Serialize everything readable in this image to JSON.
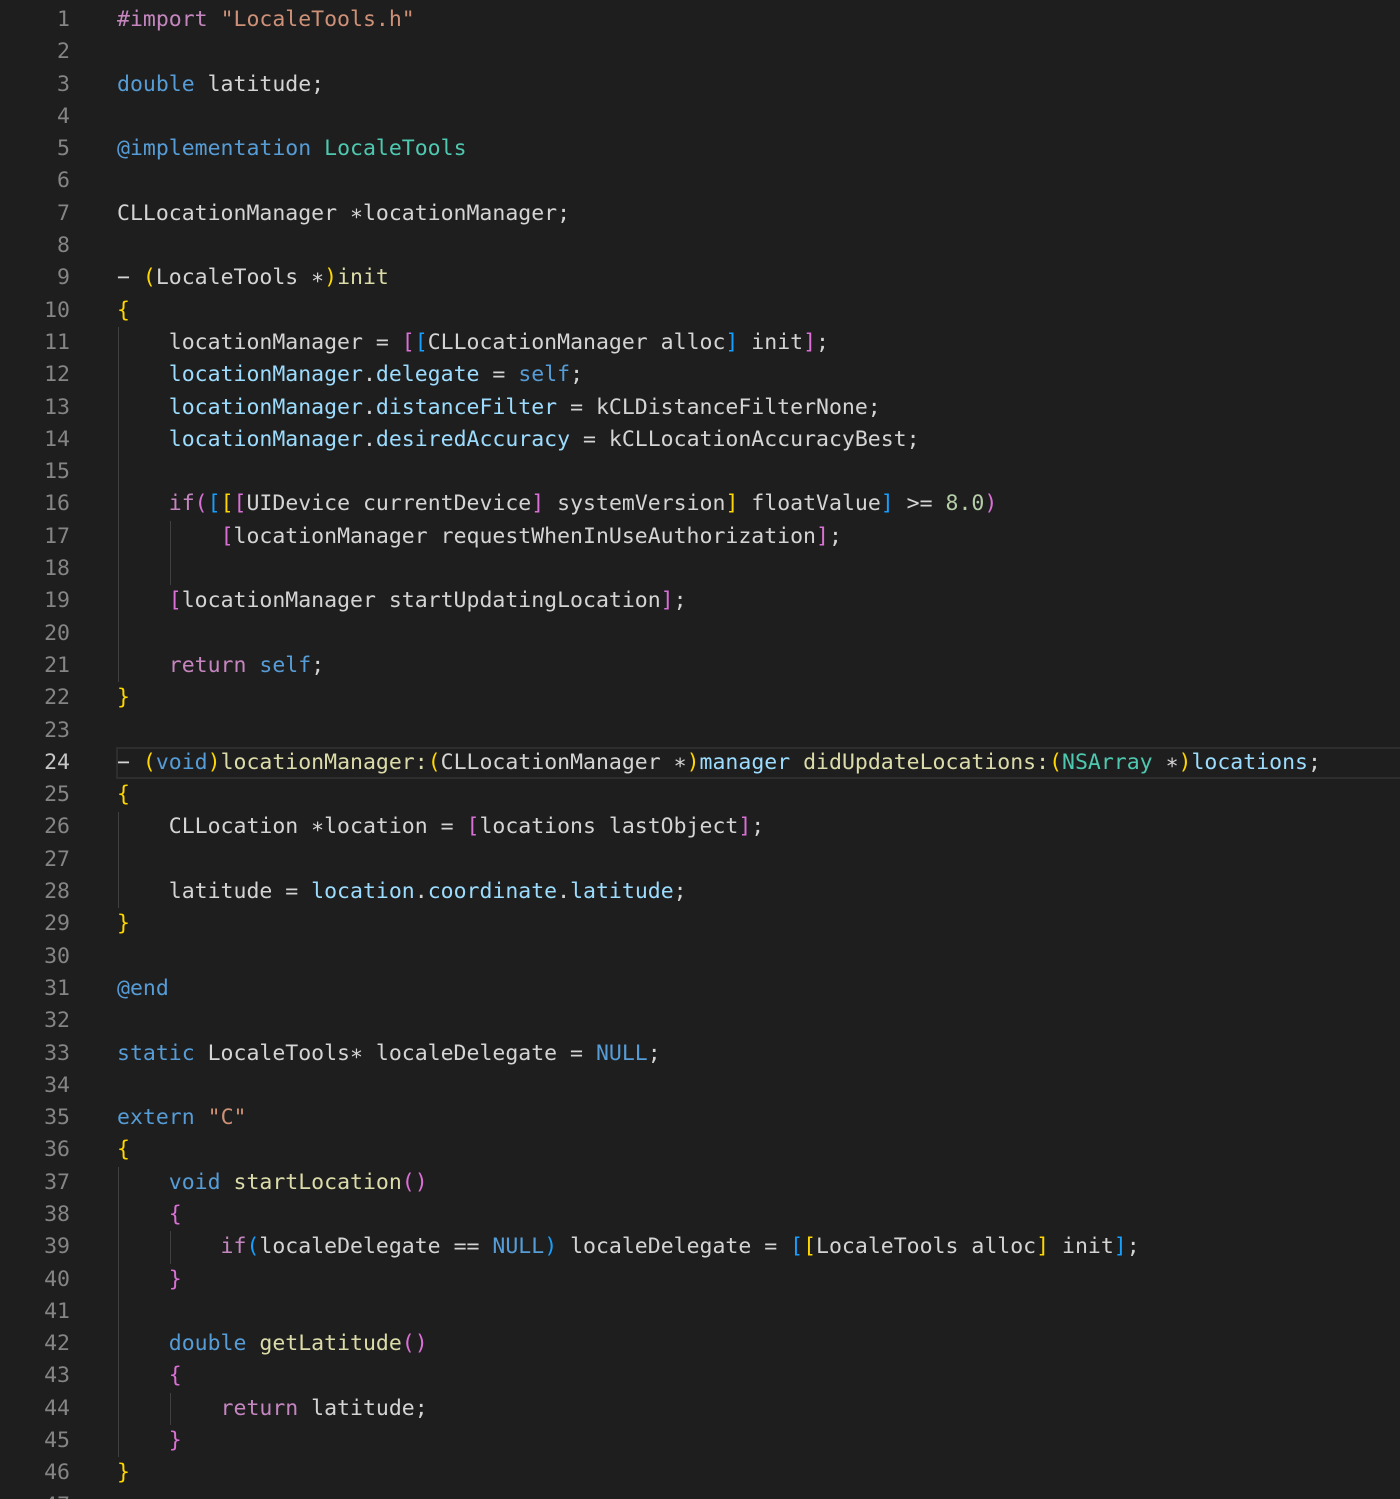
{
  "editor": {
    "language": "objective-c",
    "current_line": 24,
    "lines": [
      {
        "n": "1",
        "tokens": [
          [
            "t-pre",
            "#import "
          ],
          [
            "t-str",
            "\"LocaleTools.h\""
          ]
        ]
      },
      {
        "n": "2",
        "tokens": []
      },
      {
        "n": "3",
        "tokens": [
          [
            "t-kw",
            "double"
          ],
          [
            "t-var",
            " latitude;"
          ]
        ]
      },
      {
        "n": "4",
        "tokens": []
      },
      {
        "n": "5",
        "tokens": [
          [
            "t-kw",
            "@implementation"
          ],
          [
            "t-var",
            " "
          ],
          [
            "t-type",
            "LocaleTools"
          ]
        ]
      },
      {
        "n": "6",
        "tokens": []
      },
      {
        "n": "7",
        "tokens": [
          [
            "t-var",
            "CLLocationManager ∗locationManager;"
          ]
        ]
      },
      {
        "n": "8",
        "tokens": []
      },
      {
        "n": "9",
        "tokens": [
          [
            "t-var",
            "− "
          ],
          [
            "t-b1",
            "("
          ],
          [
            "t-var",
            "LocaleTools ∗"
          ],
          [
            "t-b1",
            ")"
          ],
          [
            "t-fn",
            "init"
          ]
        ]
      },
      {
        "n": "10",
        "tokens": [
          [
            "t-b1",
            "{"
          ]
        ]
      },
      {
        "n": "11",
        "tokens": [
          [
            "t-var",
            "    locationManager = "
          ],
          [
            "t-b2",
            "["
          ],
          [
            "t-b3",
            "["
          ],
          [
            "t-var",
            "CLLocationManager alloc"
          ],
          [
            "t-b3",
            "]"
          ],
          [
            "t-var",
            " init"
          ],
          [
            "t-b2",
            "]"
          ],
          [
            "t-var",
            ";"
          ]
        ]
      },
      {
        "n": "12",
        "tokens": [
          [
            "t-prop",
            "    locationManager"
          ],
          [
            "t-var",
            "."
          ],
          [
            "t-prop",
            "delegate"
          ],
          [
            "t-var",
            " = "
          ],
          [
            "t-kw",
            "self"
          ],
          [
            "t-var",
            ";"
          ]
        ]
      },
      {
        "n": "13",
        "tokens": [
          [
            "t-prop",
            "    locationManager"
          ],
          [
            "t-var",
            "."
          ],
          [
            "t-prop",
            "distanceFilter"
          ],
          [
            "t-var",
            " = kCLDistanceFilterNone;"
          ]
        ]
      },
      {
        "n": "14",
        "tokens": [
          [
            "t-prop",
            "    locationManager"
          ],
          [
            "t-var",
            "."
          ],
          [
            "t-prop",
            "desiredAccuracy"
          ],
          [
            "t-var",
            " = kCLLocationAccuracyBest;"
          ]
        ]
      },
      {
        "n": "15",
        "tokens": []
      },
      {
        "n": "16",
        "tokens": [
          [
            "t-kw2",
            "    if"
          ],
          [
            "t-b2",
            "("
          ],
          [
            "t-b3",
            "["
          ],
          [
            "t-b1",
            "["
          ],
          [
            "t-b2",
            "["
          ],
          [
            "t-var",
            "UIDevice currentDevice"
          ],
          [
            "t-b2",
            "]"
          ],
          [
            "t-var",
            " systemVersion"
          ],
          [
            "t-b1",
            "]"
          ],
          [
            "t-var",
            " floatValue"
          ],
          [
            "t-b3",
            "]"
          ],
          [
            "t-var",
            " >= "
          ],
          [
            "t-num",
            "8.0"
          ],
          [
            "t-b2",
            ")"
          ]
        ]
      },
      {
        "n": "17",
        "tokens": [
          [
            "t-var",
            "        "
          ],
          [
            "t-b2",
            "["
          ],
          [
            "t-var",
            "locationManager requestWhenInUseAuthorization"
          ],
          [
            "t-b2",
            "]"
          ],
          [
            "t-var",
            ";"
          ]
        ]
      },
      {
        "n": "18",
        "tokens": []
      },
      {
        "n": "19",
        "tokens": [
          [
            "t-var",
            "    "
          ],
          [
            "t-b2",
            "["
          ],
          [
            "t-var",
            "locationManager startUpdatingLocation"
          ],
          [
            "t-b2",
            "]"
          ],
          [
            "t-var",
            ";"
          ]
        ]
      },
      {
        "n": "20",
        "tokens": []
      },
      {
        "n": "21",
        "tokens": [
          [
            "t-kw2",
            "    return"
          ],
          [
            "t-var",
            " "
          ],
          [
            "t-kw",
            "self"
          ],
          [
            "t-var",
            ";"
          ]
        ]
      },
      {
        "n": "22",
        "tokens": [
          [
            "t-b1",
            "}"
          ]
        ]
      },
      {
        "n": "23",
        "tokens": []
      },
      {
        "n": "24",
        "tokens": [
          [
            "t-var",
            "− "
          ],
          [
            "t-b1",
            "("
          ],
          [
            "t-kw",
            "void"
          ],
          [
            "t-b1",
            ")"
          ],
          [
            "t-fn",
            "locationManager:"
          ],
          [
            "t-b1",
            "("
          ],
          [
            "t-var",
            "CLLocationManager ∗"
          ],
          [
            "t-b1",
            ")"
          ],
          [
            "t-prop",
            "manager"
          ],
          [
            "t-var",
            " "
          ],
          [
            "t-fn",
            "didUpdateLocations:"
          ],
          [
            "t-b1",
            "("
          ],
          [
            "t-type",
            "NSArray"
          ],
          [
            "t-var",
            " ∗"
          ],
          [
            "t-b1",
            ")"
          ],
          [
            "t-prop",
            "locations"
          ],
          [
            "t-var",
            ";"
          ]
        ]
      },
      {
        "n": "25",
        "tokens": [
          [
            "t-b1",
            "{"
          ]
        ]
      },
      {
        "n": "26",
        "tokens": [
          [
            "t-var",
            "    CLLocation ∗location = "
          ],
          [
            "t-b2",
            "["
          ],
          [
            "t-var",
            "locations lastObject"
          ],
          [
            "t-b2",
            "]"
          ],
          [
            "t-var",
            ";"
          ]
        ]
      },
      {
        "n": "27",
        "tokens": []
      },
      {
        "n": "28",
        "tokens": [
          [
            "t-var",
            "    latitude = "
          ],
          [
            "t-prop",
            "location"
          ],
          [
            "t-var",
            "."
          ],
          [
            "t-prop",
            "coordinate"
          ],
          [
            "t-var",
            "."
          ],
          [
            "t-prop",
            "latitude"
          ],
          [
            "t-var",
            ";"
          ]
        ]
      },
      {
        "n": "29",
        "tokens": [
          [
            "t-b1",
            "}"
          ]
        ]
      },
      {
        "n": "30",
        "tokens": []
      },
      {
        "n": "31",
        "tokens": [
          [
            "t-kw",
            "@end"
          ]
        ]
      },
      {
        "n": "32",
        "tokens": []
      },
      {
        "n": "33",
        "tokens": [
          [
            "t-kw",
            "static"
          ],
          [
            "t-var",
            " LocaleTools∗ localeDelegate = "
          ],
          [
            "t-kw",
            "NULL"
          ],
          [
            "t-var",
            ";"
          ]
        ]
      },
      {
        "n": "34",
        "tokens": []
      },
      {
        "n": "35",
        "tokens": [
          [
            "t-kw",
            "extern"
          ],
          [
            "t-var",
            " "
          ],
          [
            "t-str",
            "\"C\""
          ]
        ]
      },
      {
        "n": "36",
        "tokens": [
          [
            "t-b1",
            "{"
          ]
        ]
      },
      {
        "n": "37",
        "tokens": [
          [
            "t-kw",
            "    void"
          ],
          [
            "t-var",
            " "
          ],
          [
            "t-fn",
            "startLocation"
          ],
          [
            "t-b2",
            "()"
          ]
        ]
      },
      {
        "n": "38",
        "tokens": [
          [
            "t-b2",
            "    {"
          ]
        ]
      },
      {
        "n": "39",
        "tokens": [
          [
            "t-kw2",
            "        if"
          ],
          [
            "t-b3",
            "("
          ],
          [
            "t-var",
            "localeDelegate == "
          ],
          [
            "t-kw",
            "NULL"
          ],
          [
            "t-b3",
            ")"
          ],
          [
            "t-var",
            " localeDelegate = "
          ],
          [
            "t-b3",
            "["
          ],
          [
            "t-b1",
            "["
          ],
          [
            "t-var",
            "LocaleTools alloc"
          ],
          [
            "t-b1",
            "]"
          ],
          [
            "t-var",
            " init"
          ],
          [
            "t-b3",
            "]"
          ],
          [
            "t-var",
            ";"
          ]
        ]
      },
      {
        "n": "40",
        "tokens": [
          [
            "t-b2",
            "    }"
          ]
        ]
      },
      {
        "n": "41",
        "tokens": []
      },
      {
        "n": "42",
        "tokens": [
          [
            "t-kw",
            "    double"
          ],
          [
            "t-var",
            " "
          ],
          [
            "t-fn",
            "getLatitude"
          ],
          [
            "t-b2",
            "()"
          ]
        ]
      },
      {
        "n": "43",
        "tokens": [
          [
            "t-b2",
            "    {"
          ]
        ]
      },
      {
        "n": "44",
        "tokens": [
          [
            "t-kw2",
            "        return"
          ],
          [
            "t-var",
            " latitude;"
          ]
        ]
      },
      {
        "n": "45",
        "tokens": [
          [
            "t-b2",
            "    }"
          ]
        ]
      },
      {
        "n": "46",
        "tokens": [
          [
            "t-b1",
            "}"
          ]
        ]
      },
      {
        "n": "47",
        "tokens": []
      }
    ]
  }
}
